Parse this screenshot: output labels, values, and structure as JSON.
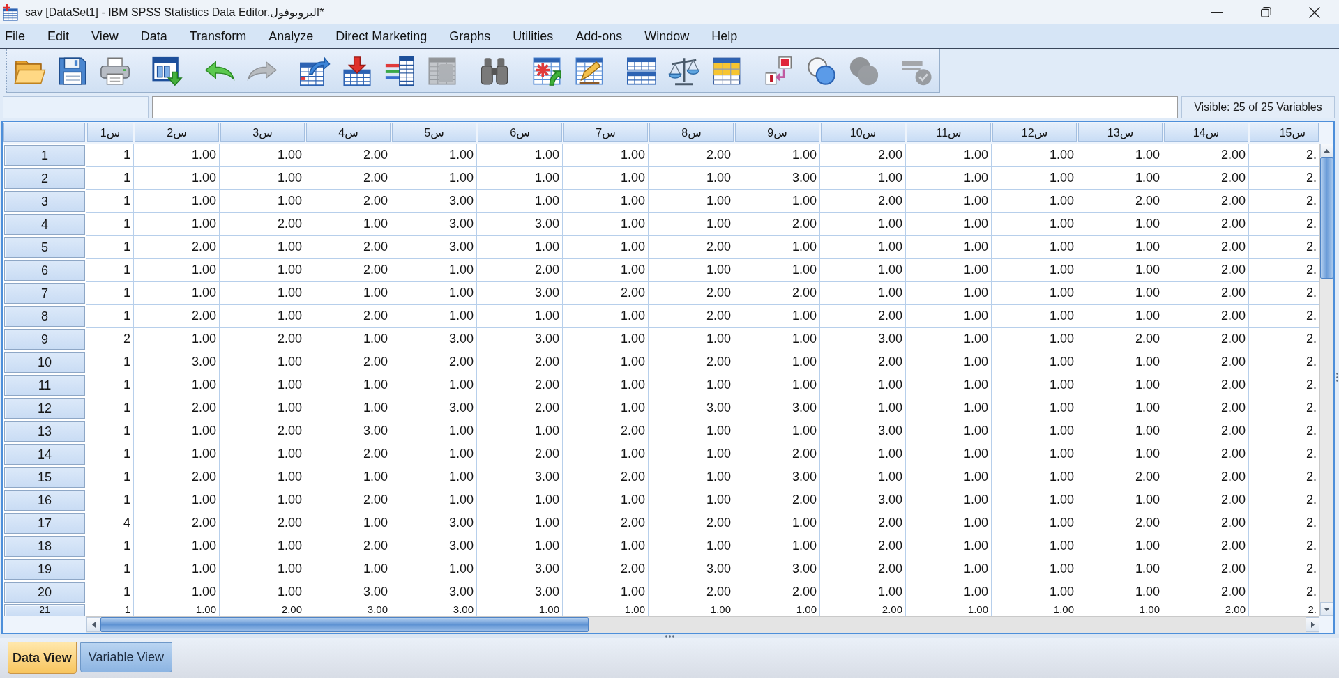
{
  "window": {
    "title": "sav [DataSet1] - IBM SPSS Statistics Data Editor.البروبوفول*"
  },
  "menu_bar": [
    "File",
    "Edit",
    "View",
    "Data",
    "Transform",
    "Analyze",
    "Direct Marketing",
    "Graphs",
    "Utilities",
    "Add-ons",
    "Window",
    "Help"
  ],
  "toolbar_groups": [
    {
      "buttons": [
        {
          "kind": "open",
          "disabled": false
        },
        {
          "kind": "save",
          "disabled": false
        },
        {
          "kind": "print",
          "disabled": false
        }
      ]
    },
    {
      "buttons": [
        {
          "kind": "recall",
          "disabled": false
        }
      ]
    },
    {
      "buttons": [
        {
          "kind": "undo",
          "disabled": false
        },
        {
          "kind": "redo",
          "disabled": true
        }
      ]
    },
    {
      "buttons": [
        {
          "kind": "goto_case",
          "disabled": false
        },
        {
          "kind": "goto_variable",
          "disabled": false
        },
        {
          "kind": "variables",
          "disabled": false
        },
        {
          "kind": "descriptives",
          "disabled": true
        }
      ]
    },
    {
      "buttons": [
        {
          "kind": "find",
          "disabled": false
        }
      ]
    },
    {
      "buttons": [
        {
          "kind": "insert_cases",
          "disabled": false
        },
        {
          "kind": "insert_variable",
          "disabled": false
        }
      ]
    },
    {
      "buttons": [
        {
          "kind": "split_file",
          "disabled": false
        },
        {
          "kind": "weight_cases",
          "disabled": false
        },
        {
          "kind": "select_cases",
          "disabled": false
        }
      ]
    },
    {
      "buttons": [
        {
          "kind": "value_labels",
          "disabled": false
        },
        {
          "kind": "variable_sets",
          "disabled": false
        },
        {
          "kind": "show_all",
          "disabled": true
        }
      ]
    },
    {
      "buttons": [
        {
          "kind": "spell_check",
          "disabled": true
        }
      ]
    }
  ],
  "cell_editor": {
    "status": "Visible: 25 of 25 Variables"
  },
  "data_grid": {
    "columns": [
      "س1",
      "س2",
      "س3",
      "س4",
      "س5",
      "س6",
      "س7",
      "س8",
      "س9",
      "س10",
      "س11",
      "س12",
      "س13",
      "س14",
      "س15"
    ],
    "rows": [
      {
        "number": "1",
        "cells": [
          "1",
          "1.00",
          "1.00",
          "2.00",
          "1.00",
          "1.00",
          "1.00",
          "2.00",
          "1.00",
          "2.00",
          "1.00",
          "1.00",
          "1.00",
          "2.00",
          "2."
        ]
      },
      {
        "number": "2",
        "cells": [
          "1",
          "1.00",
          "1.00",
          "2.00",
          "1.00",
          "1.00",
          "1.00",
          "1.00",
          "3.00",
          "1.00",
          "1.00",
          "1.00",
          "1.00",
          "2.00",
          "2."
        ]
      },
      {
        "number": "3",
        "cells": [
          "1",
          "1.00",
          "1.00",
          "2.00",
          "3.00",
          "1.00",
          "1.00",
          "1.00",
          "1.00",
          "2.00",
          "1.00",
          "1.00",
          "2.00",
          "2.00",
          "2."
        ]
      },
      {
        "number": "4",
        "cells": [
          "1",
          "1.00",
          "2.00",
          "1.00",
          "3.00",
          "3.00",
          "1.00",
          "1.00",
          "2.00",
          "1.00",
          "1.00",
          "1.00",
          "1.00",
          "2.00",
          "2."
        ]
      },
      {
        "number": "5",
        "cells": [
          "1",
          "2.00",
          "1.00",
          "2.00",
          "3.00",
          "1.00",
          "1.00",
          "2.00",
          "1.00",
          "1.00",
          "1.00",
          "1.00",
          "1.00",
          "2.00",
          "2."
        ]
      },
      {
        "number": "6",
        "cells": [
          "1",
          "1.00",
          "1.00",
          "2.00",
          "1.00",
          "2.00",
          "1.00",
          "1.00",
          "1.00",
          "1.00",
          "1.00",
          "1.00",
          "1.00",
          "2.00",
          "2."
        ]
      },
      {
        "number": "7",
        "cells": [
          "1",
          "1.00",
          "1.00",
          "1.00",
          "1.00",
          "3.00",
          "2.00",
          "2.00",
          "2.00",
          "1.00",
          "1.00",
          "1.00",
          "1.00",
          "2.00",
          "2."
        ]
      },
      {
        "number": "8",
        "cells": [
          "1",
          "2.00",
          "1.00",
          "2.00",
          "1.00",
          "1.00",
          "1.00",
          "2.00",
          "1.00",
          "2.00",
          "1.00",
          "1.00",
          "1.00",
          "2.00",
          "2."
        ]
      },
      {
        "number": "9",
        "cells": [
          "2",
          "1.00",
          "2.00",
          "1.00",
          "3.00",
          "3.00",
          "1.00",
          "1.00",
          "1.00",
          "3.00",
          "1.00",
          "1.00",
          "2.00",
          "2.00",
          "2."
        ]
      },
      {
        "number": "10",
        "cells": [
          "1",
          "3.00",
          "1.00",
          "2.00",
          "2.00",
          "2.00",
          "1.00",
          "2.00",
          "1.00",
          "2.00",
          "1.00",
          "1.00",
          "1.00",
          "2.00",
          "2."
        ]
      },
      {
        "number": "11",
        "cells": [
          "1",
          "1.00",
          "1.00",
          "1.00",
          "1.00",
          "2.00",
          "1.00",
          "1.00",
          "1.00",
          "1.00",
          "1.00",
          "1.00",
          "1.00",
          "2.00",
          "2."
        ]
      },
      {
        "number": "12",
        "cells": [
          "1",
          "2.00",
          "1.00",
          "1.00",
          "3.00",
          "2.00",
          "1.00",
          "3.00",
          "3.00",
          "1.00",
          "1.00",
          "1.00",
          "1.00",
          "2.00",
          "2."
        ]
      },
      {
        "number": "13",
        "cells": [
          "1",
          "1.00",
          "2.00",
          "3.00",
          "1.00",
          "1.00",
          "2.00",
          "1.00",
          "1.00",
          "3.00",
          "1.00",
          "1.00",
          "1.00",
          "2.00",
          "2."
        ]
      },
      {
        "number": "14",
        "cells": [
          "1",
          "1.00",
          "1.00",
          "2.00",
          "1.00",
          "2.00",
          "1.00",
          "1.00",
          "2.00",
          "1.00",
          "1.00",
          "1.00",
          "1.00",
          "2.00",
          "2."
        ]
      },
      {
        "number": "15",
        "cells": [
          "1",
          "2.00",
          "1.00",
          "1.00",
          "1.00",
          "3.00",
          "2.00",
          "1.00",
          "3.00",
          "1.00",
          "1.00",
          "1.00",
          "2.00",
          "2.00",
          "2."
        ]
      },
      {
        "number": "16",
        "cells": [
          "1",
          "1.00",
          "1.00",
          "2.00",
          "1.00",
          "1.00",
          "1.00",
          "1.00",
          "2.00",
          "3.00",
          "1.00",
          "1.00",
          "1.00",
          "2.00",
          "2."
        ]
      },
      {
        "number": "17",
        "cells": [
          "4",
          "2.00",
          "2.00",
          "1.00",
          "3.00",
          "1.00",
          "2.00",
          "2.00",
          "1.00",
          "2.00",
          "1.00",
          "1.00",
          "2.00",
          "2.00",
          "2."
        ]
      },
      {
        "number": "18",
        "cells": [
          "1",
          "1.00",
          "1.00",
          "2.00",
          "3.00",
          "1.00",
          "1.00",
          "1.00",
          "1.00",
          "2.00",
          "1.00",
          "1.00",
          "1.00",
          "2.00",
          "2."
        ]
      },
      {
        "number": "19",
        "cells": [
          "1",
          "1.00",
          "1.00",
          "1.00",
          "1.00",
          "3.00",
          "2.00",
          "3.00",
          "3.00",
          "2.00",
          "1.00",
          "1.00",
          "1.00",
          "2.00",
          "2."
        ]
      },
      {
        "number": "20",
        "cells": [
          "1",
          "1.00",
          "1.00",
          "3.00",
          "3.00",
          "3.00",
          "1.00",
          "2.00",
          "2.00",
          "1.00",
          "1.00",
          "1.00",
          "1.00",
          "2.00",
          "2."
        ]
      },
      {
        "number": "21",
        "cells": [
          "1",
          "1.00",
          "2.00",
          "3.00",
          "3.00",
          "1.00",
          "1.00",
          "1.00",
          "1.00",
          "2.00",
          "1.00",
          "1.00",
          "1.00",
          "2.00",
          "2."
        ]
      }
    ]
  },
  "view_tabs": [
    {
      "label": "Data View",
      "selected": true
    },
    {
      "label": "Variable View",
      "selected": false
    }
  ]
}
